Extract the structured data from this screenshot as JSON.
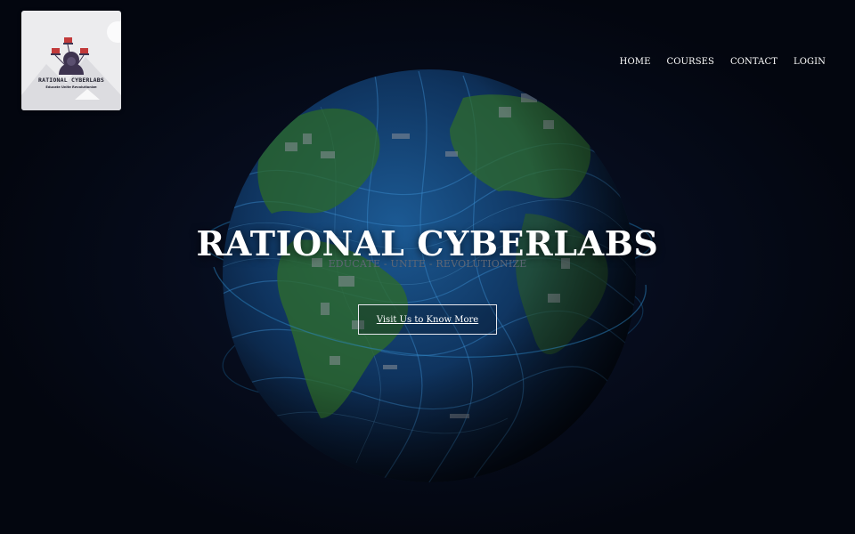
{
  "brand": {
    "logo_title": "RATIONAL CYBERLABS",
    "logo_tagline": "Educate Unite Revolutionize"
  },
  "nav": {
    "items": [
      {
        "label": "HOME"
      },
      {
        "label": "COURSES"
      },
      {
        "label": "CONTACT"
      },
      {
        "label": "LOGIN"
      }
    ]
  },
  "hero": {
    "title": "RATIONAL CYBERLABS",
    "tagline": "EDUCATE - UNITE - REVOLUTIONIZE",
    "cta_label": "Visit Us to Know More",
    "background_icon": "globe-circuit-image"
  },
  "colors": {
    "background": "#03060f",
    "text": "#ffffff",
    "tagline": "#5f6775",
    "globe_ocean": "#123a6e",
    "globe_land": "#2c6a2a"
  }
}
